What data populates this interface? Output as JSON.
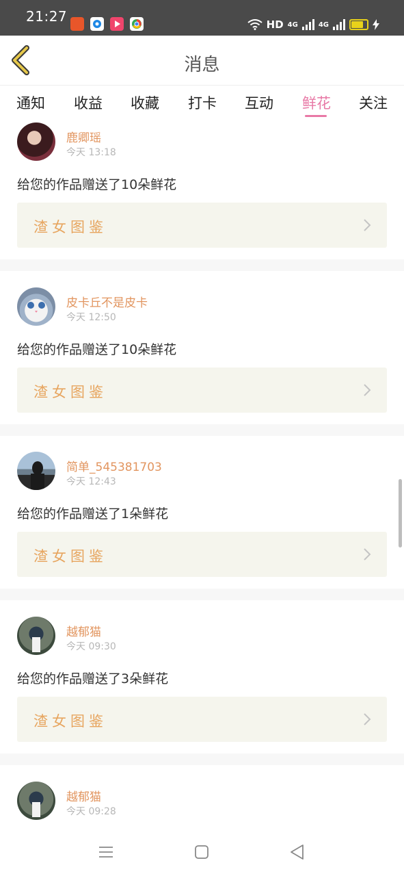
{
  "status_bar": {
    "time": "21:27",
    "hd": "HD",
    "network1": "4G",
    "network2": "4G",
    "battery_color": "#e8d21a"
  },
  "header": {
    "title": "消息",
    "back_icon": "chevron-left-icon"
  },
  "tabs": [
    {
      "label": "通知",
      "active": false
    },
    {
      "label": "收益",
      "active": false
    },
    {
      "label": "收藏",
      "active": false
    },
    {
      "label": "打卡",
      "active": false
    },
    {
      "label": "互动",
      "active": false
    },
    {
      "label": "鲜花",
      "active": true
    },
    {
      "label": "关注",
      "active": false
    }
  ],
  "messages": [
    {
      "username": "鹿卿瑶",
      "time": "今天 13:18",
      "text": "给您的作品赠送了10朵鲜花",
      "work": "渣女图鉴"
    },
    {
      "username": "皮卡丘不是皮卡",
      "time": "今天 12:50",
      "text": "给您的作品赠送了10朵鲜花",
      "work": "渣女图鉴"
    },
    {
      "username": "简单_545381703",
      "time": "今天 12:43",
      "text": "给您的作品赠送了1朵鲜花",
      "work": "渣女图鉴"
    },
    {
      "username": "越郁猫",
      "time": "今天 09:30",
      "text": "给您的作品赠送了3朵鲜花",
      "work": "渣女图鉴"
    },
    {
      "username": "越郁猫",
      "time": "今天 09:28"
    }
  ],
  "colors": {
    "accent": "#e879a6",
    "username": "#e2955f",
    "work_title": "#e7a55f",
    "work_bg": "#f5f5ed"
  }
}
